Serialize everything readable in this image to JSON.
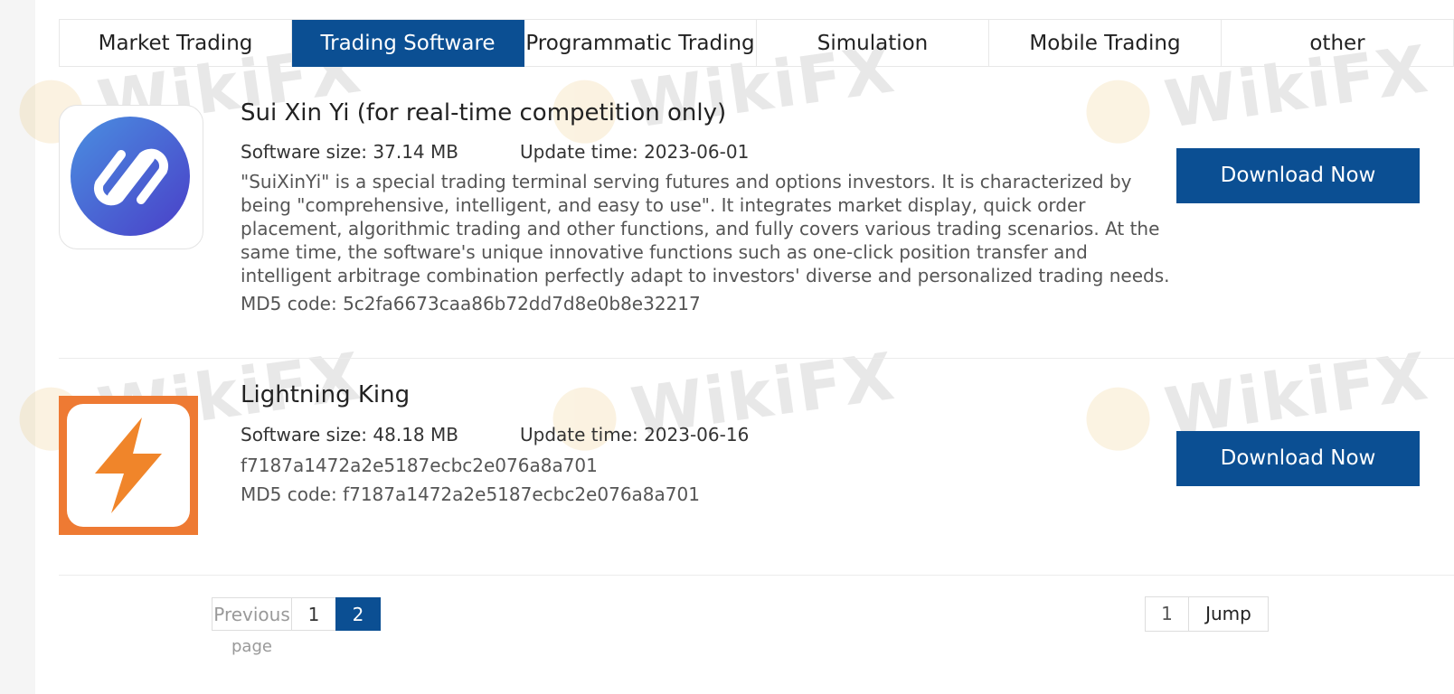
{
  "tabs": [
    {
      "label": "Market Trading"
    },
    {
      "label": "Trading Software"
    },
    {
      "label": "Programmatic Trading"
    },
    {
      "label": "Simulation"
    },
    {
      "label": "Mobile Trading"
    },
    {
      "label": "other"
    }
  ],
  "active_tab": "Trading Software",
  "software": [
    {
      "title": "Sui Xin Yi (for real-time competition only)",
      "size": "Software size: 37.14 MB",
      "update": "Update time: 2023-06-01",
      "description": "\"SuiXinYi\" is a special trading terminal serving futures and options investors. It is characterized by being \"comprehensive, intelligent, and easy to use\". It integrates market display, quick order placement, algorithmic trading and other functions, and fully covers various trading scenarios. At the same time, the software's unique innovative functions such as one-click position transfer and intelligent arbitrage combination perfectly adapt to investors' diverse and personalized trading needs.",
      "md5": "MD5 code: 5c2fa6673caa86b72dd7d8e0b8e32217",
      "download_label": "Download Now",
      "icon": "link-loop-icon",
      "icon_color": "#3b6fd8"
    },
    {
      "title": "Lightning King",
      "size": "Software size: 48.18 MB",
      "update": "Update time: 2023-06-16",
      "hash": "f7187a1472a2e5187ecbc2e076a8a701",
      "md5": "MD5 code: f7187a1472a2e5187ecbc2e076a8a701",
      "download_label": "Download Now",
      "icon": "lightning-bolt-icon",
      "icon_color": "#f0852a"
    }
  ],
  "pagination": {
    "previous_label": "Previous",
    "pages": [
      "1",
      "2"
    ],
    "current_page": "2",
    "page_word": "page",
    "jump_value": "1",
    "jump_label": "Jump"
  },
  "watermark_text": "WikiFX",
  "colors": {
    "accent": "#0b4f93",
    "border": "#e8e8e8"
  }
}
